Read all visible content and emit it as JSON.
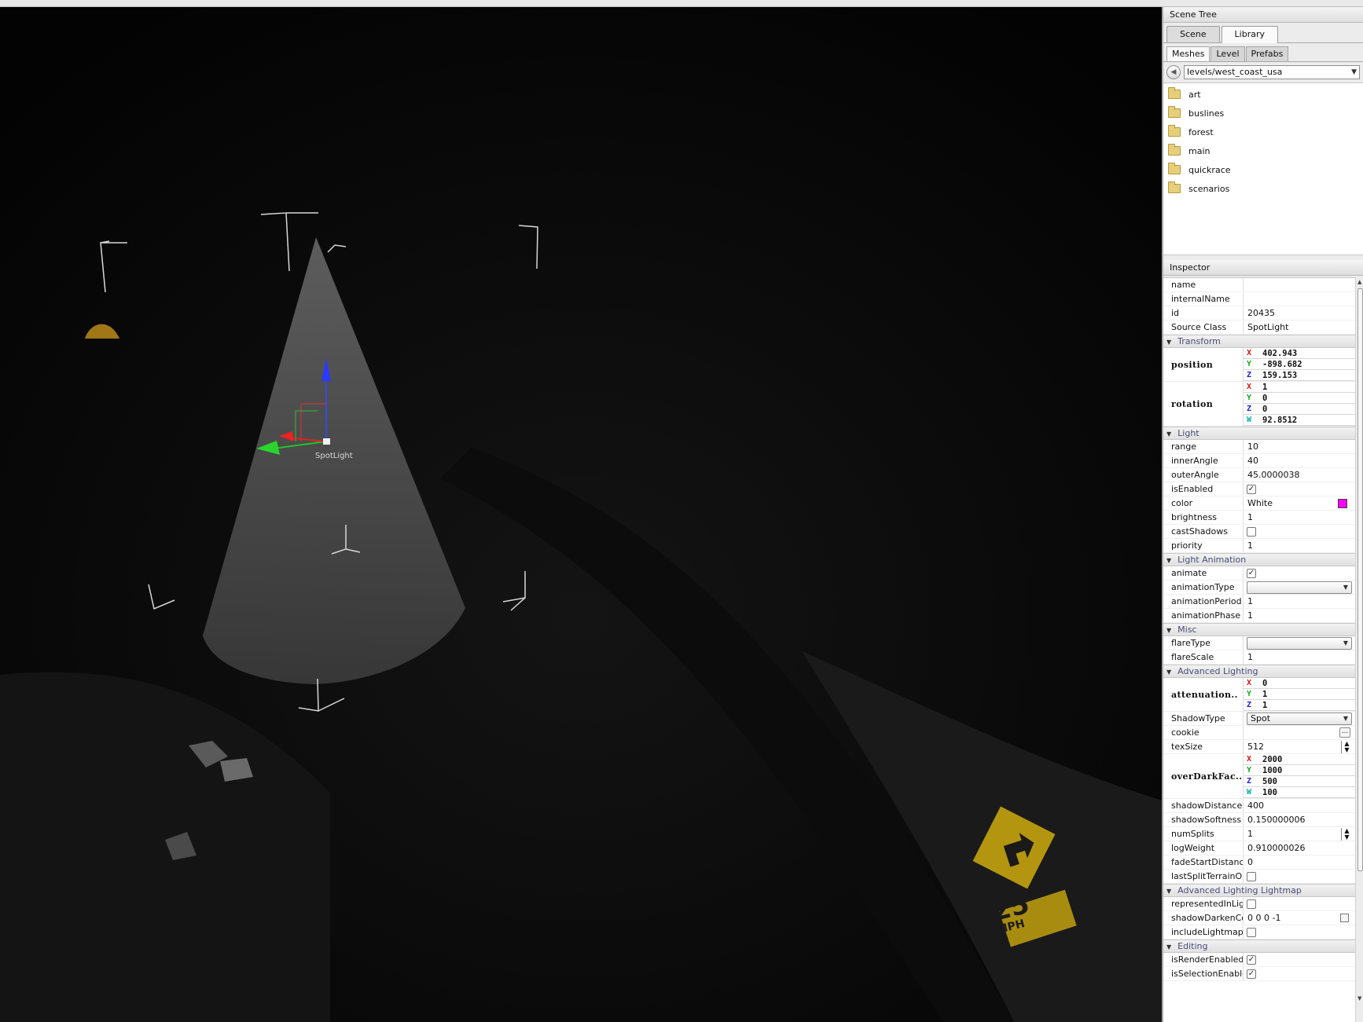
{
  "viewport": {
    "object_label": "SpotLight",
    "sign_speed": "25",
    "sign_unit": "MPH"
  },
  "scene_tree": {
    "title": "Scene Tree",
    "tabs": [
      "Scene",
      "Library"
    ],
    "active_tab": "Library",
    "subtabs": [
      "Meshes",
      "Level",
      "Prefabs"
    ],
    "active_subtab": "Meshes",
    "path": "levels/west_coast_usa",
    "folders": [
      "art",
      "buslines",
      "forest",
      "main",
      "quickrace",
      "scenarios"
    ]
  },
  "inspector": {
    "title": "Inspector",
    "name": {
      "label": "name",
      "value": ""
    },
    "internalName": {
      "label": "internalName",
      "value": ""
    },
    "id": {
      "label": "id",
      "value": "20435"
    },
    "sourceClass": {
      "label": "Source Class",
      "value": "SpotLight"
    },
    "transform": {
      "title": "Transform",
      "position": {
        "label": "position",
        "x": "402.943",
        "y": "-898.682",
        "z": "159.153"
      },
      "rotation": {
        "label": "rotation",
        "x": "1",
        "y": "0",
        "z": "0",
        "w": "92.8512"
      }
    },
    "light": {
      "title": "Light",
      "range": {
        "label": "range",
        "value": "10"
      },
      "innerAngle": {
        "label": "innerAngle",
        "value": "40"
      },
      "outerAngle": {
        "label": "outerAngle",
        "value": "45.0000038"
      },
      "isEnabled": {
        "label": "isEnabled",
        "checked": true
      },
      "color": {
        "label": "color",
        "value": "White",
        "swatch": "#ff00ff"
      },
      "brightness": {
        "label": "brightness",
        "value": "1"
      },
      "castShadows": {
        "label": "castShadows",
        "checked": false
      },
      "priority": {
        "label": "priority",
        "value": "1"
      }
    },
    "light_animation": {
      "title": "Light Animation",
      "animate": {
        "label": "animate",
        "checked": true
      },
      "animationType": {
        "label": "animationType",
        "value": ""
      },
      "animationPeriod": {
        "label": "animationPeriod",
        "value": "1"
      },
      "animationPhase": {
        "label": "animationPhase",
        "value": "1"
      }
    },
    "misc": {
      "title": "Misc",
      "flareType": {
        "label": "flareType",
        "value": ""
      },
      "flareScale": {
        "label": "flareScale",
        "value": "1"
      }
    },
    "advanced_lighting": {
      "title": "Advanced Lighting",
      "attenuation": {
        "label": "attenuation..",
        "x": "0",
        "y": "1",
        "z": "1"
      },
      "shadowType": {
        "label": "ShadowType",
        "value": "Spot"
      },
      "cookie": {
        "label": "cookie",
        "button": "..."
      },
      "texSize": {
        "label": "texSize",
        "value": "512"
      },
      "overDarkFac": {
        "label": "overDarkFac..",
        "x": "2000",
        "y": "1000",
        "z": "500",
        "w": "100"
      },
      "shadowDistance": {
        "label": "shadowDistance",
        "value": "400"
      },
      "shadowSoftness": {
        "label": "shadowSoftness",
        "value": "0.150000006"
      },
      "numSplits": {
        "label": "numSplits",
        "value": "1"
      },
      "logWeight": {
        "label": "logWeight",
        "value": "0.910000026"
      },
      "fadeStartDistance": {
        "label": "fadeStartDistance",
        "value": "0"
      },
      "lastSplitTerrainOnly": {
        "label": "lastSplitTerrainOnly",
        "checked": false
      }
    },
    "advanced_lighting_lightmap": {
      "title": "Advanced Lighting Lightmap",
      "representedInLightmap": {
        "label": "representedInLigh..",
        "checked": false
      },
      "shadowDarkenColor": {
        "label": "shadowDarkenCo..",
        "value": "0 0 0 -1"
      },
      "includeLightmappedGeometry": {
        "label": "includeLightmapp..",
        "checked": false
      }
    },
    "editing": {
      "title": "Editing",
      "isRenderEnabled": {
        "label": "isRenderEnabled",
        "checked": true
      },
      "isSelectionEnabled": {
        "label": "isSelectionEnabled",
        "checked": true
      }
    }
  }
}
